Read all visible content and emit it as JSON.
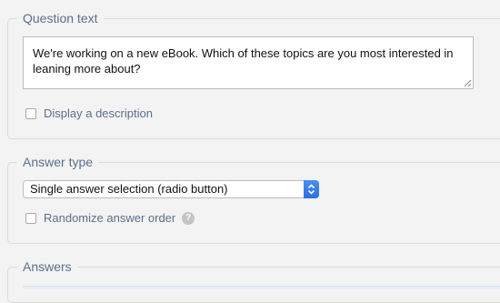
{
  "question_section": {
    "legend": "Question text",
    "question_text": "We're working on a new eBook. Which of these topics are you most interested in leaning more about?",
    "display_description_label": "Display a description"
  },
  "answer_type_section": {
    "legend": "Answer type",
    "selected_type": "Single answer selection (radio button)",
    "randomize_label": "Randomize answer order",
    "help_glyph": "?"
  },
  "answers_section": {
    "legend": "Answers"
  },
  "icons": {
    "select_arrows": "chevron-up-down-icon",
    "help": "question-mark-icon",
    "resize": "resize-grip-icon"
  },
  "colors": {
    "legend_text": "#5b6f8c",
    "select_accent": "#3b82f0",
    "background": "#f3f3f3"
  }
}
